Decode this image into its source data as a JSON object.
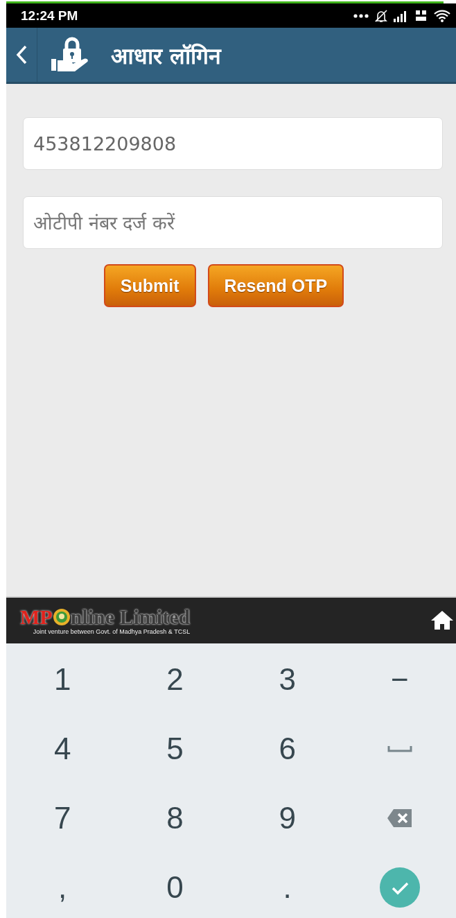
{
  "status_bar": {
    "time": "12:24 PM"
  },
  "header": {
    "title": "आधार लॉगिन"
  },
  "form": {
    "fields": [
      {
        "value": "453812209808"
      },
      {
        "placeholder": "ओटीपी नंबर दर्ज करें"
      }
    ],
    "buttons": [
      "Submit",
      "Resend OTP"
    ]
  },
  "footer": {
    "logo": {
      "prefix": "MP",
      "suffix": "nline Limited",
      "tagline": "Joint venture between Govt. of Madhya Pradesh & TCSL"
    }
  },
  "keyboard": {
    "keys": [
      {
        "kind": "text",
        "label": "1"
      },
      {
        "kind": "text",
        "label": "2"
      },
      {
        "kind": "text",
        "label": "3"
      },
      {
        "kind": "text",
        "label": "−"
      },
      {
        "kind": "text",
        "label": "4"
      },
      {
        "kind": "text",
        "label": "5"
      },
      {
        "kind": "text",
        "label": "6"
      },
      {
        "kind": "space"
      },
      {
        "kind": "text",
        "label": "7"
      },
      {
        "kind": "text",
        "label": "8"
      },
      {
        "kind": "text",
        "label": "9"
      },
      {
        "kind": "backspace"
      },
      {
        "kind": "text",
        "label": ","
      },
      {
        "kind": "text",
        "label": "0"
      },
      {
        "kind": "text",
        "label": "."
      },
      {
        "kind": "done"
      }
    ]
  }
}
